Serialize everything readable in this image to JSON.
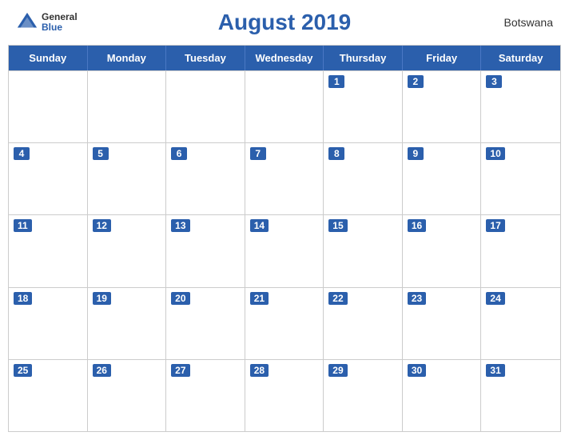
{
  "header": {
    "logo_general": "General",
    "logo_blue": "Blue",
    "title": "August 2019",
    "country": "Botswana"
  },
  "calendar": {
    "day_headers": [
      "Sunday",
      "Monday",
      "Tuesday",
      "Wednesday",
      "Thursday",
      "Friday",
      "Saturday"
    ],
    "weeks": [
      [
        {
          "date": "",
          "empty": true
        },
        {
          "date": "",
          "empty": true
        },
        {
          "date": "",
          "empty": true
        },
        {
          "date": "",
          "empty": true
        },
        {
          "date": "1",
          "empty": false
        },
        {
          "date": "2",
          "empty": false
        },
        {
          "date": "3",
          "empty": false
        }
      ],
      [
        {
          "date": "4",
          "empty": false
        },
        {
          "date": "5",
          "empty": false
        },
        {
          "date": "6",
          "empty": false
        },
        {
          "date": "7",
          "empty": false
        },
        {
          "date": "8",
          "empty": false
        },
        {
          "date": "9",
          "empty": false
        },
        {
          "date": "10",
          "empty": false
        }
      ],
      [
        {
          "date": "11",
          "empty": false
        },
        {
          "date": "12",
          "empty": false
        },
        {
          "date": "13",
          "empty": false
        },
        {
          "date": "14",
          "empty": false
        },
        {
          "date": "15",
          "empty": false
        },
        {
          "date": "16",
          "empty": false
        },
        {
          "date": "17",
          "empty": false
        }
      ],
      [
        {
          "date": "18",
          "empty": false
        },
        {
          "date": "19",
          "empty": false
        },
        {
          "date": "20",
          "empty": false
        },
        {
          "date": "21",
          "empty": false
        },
        {
          "date": "22",
          "empty": false
        },
        {
          "date": "23",
          "empty": false
        },
        {
          "date": "24",
          "empty": false
        }
      ],
      [
        {
          "date": "25",
          "empty": false
        },
        {
          "date": "26",
          "empty": false
        },
        {
          "date": "27",
          "empty": false
        },
        {
          "date": "28",
          "empty": false
        },
        {
          "date": "29",
          "empty": false
        },
        {
          "date": "30",
          "empty": false
        },
        {
          "date": "31",
          "empty": false
        }
      ]
    ]
  }
}
